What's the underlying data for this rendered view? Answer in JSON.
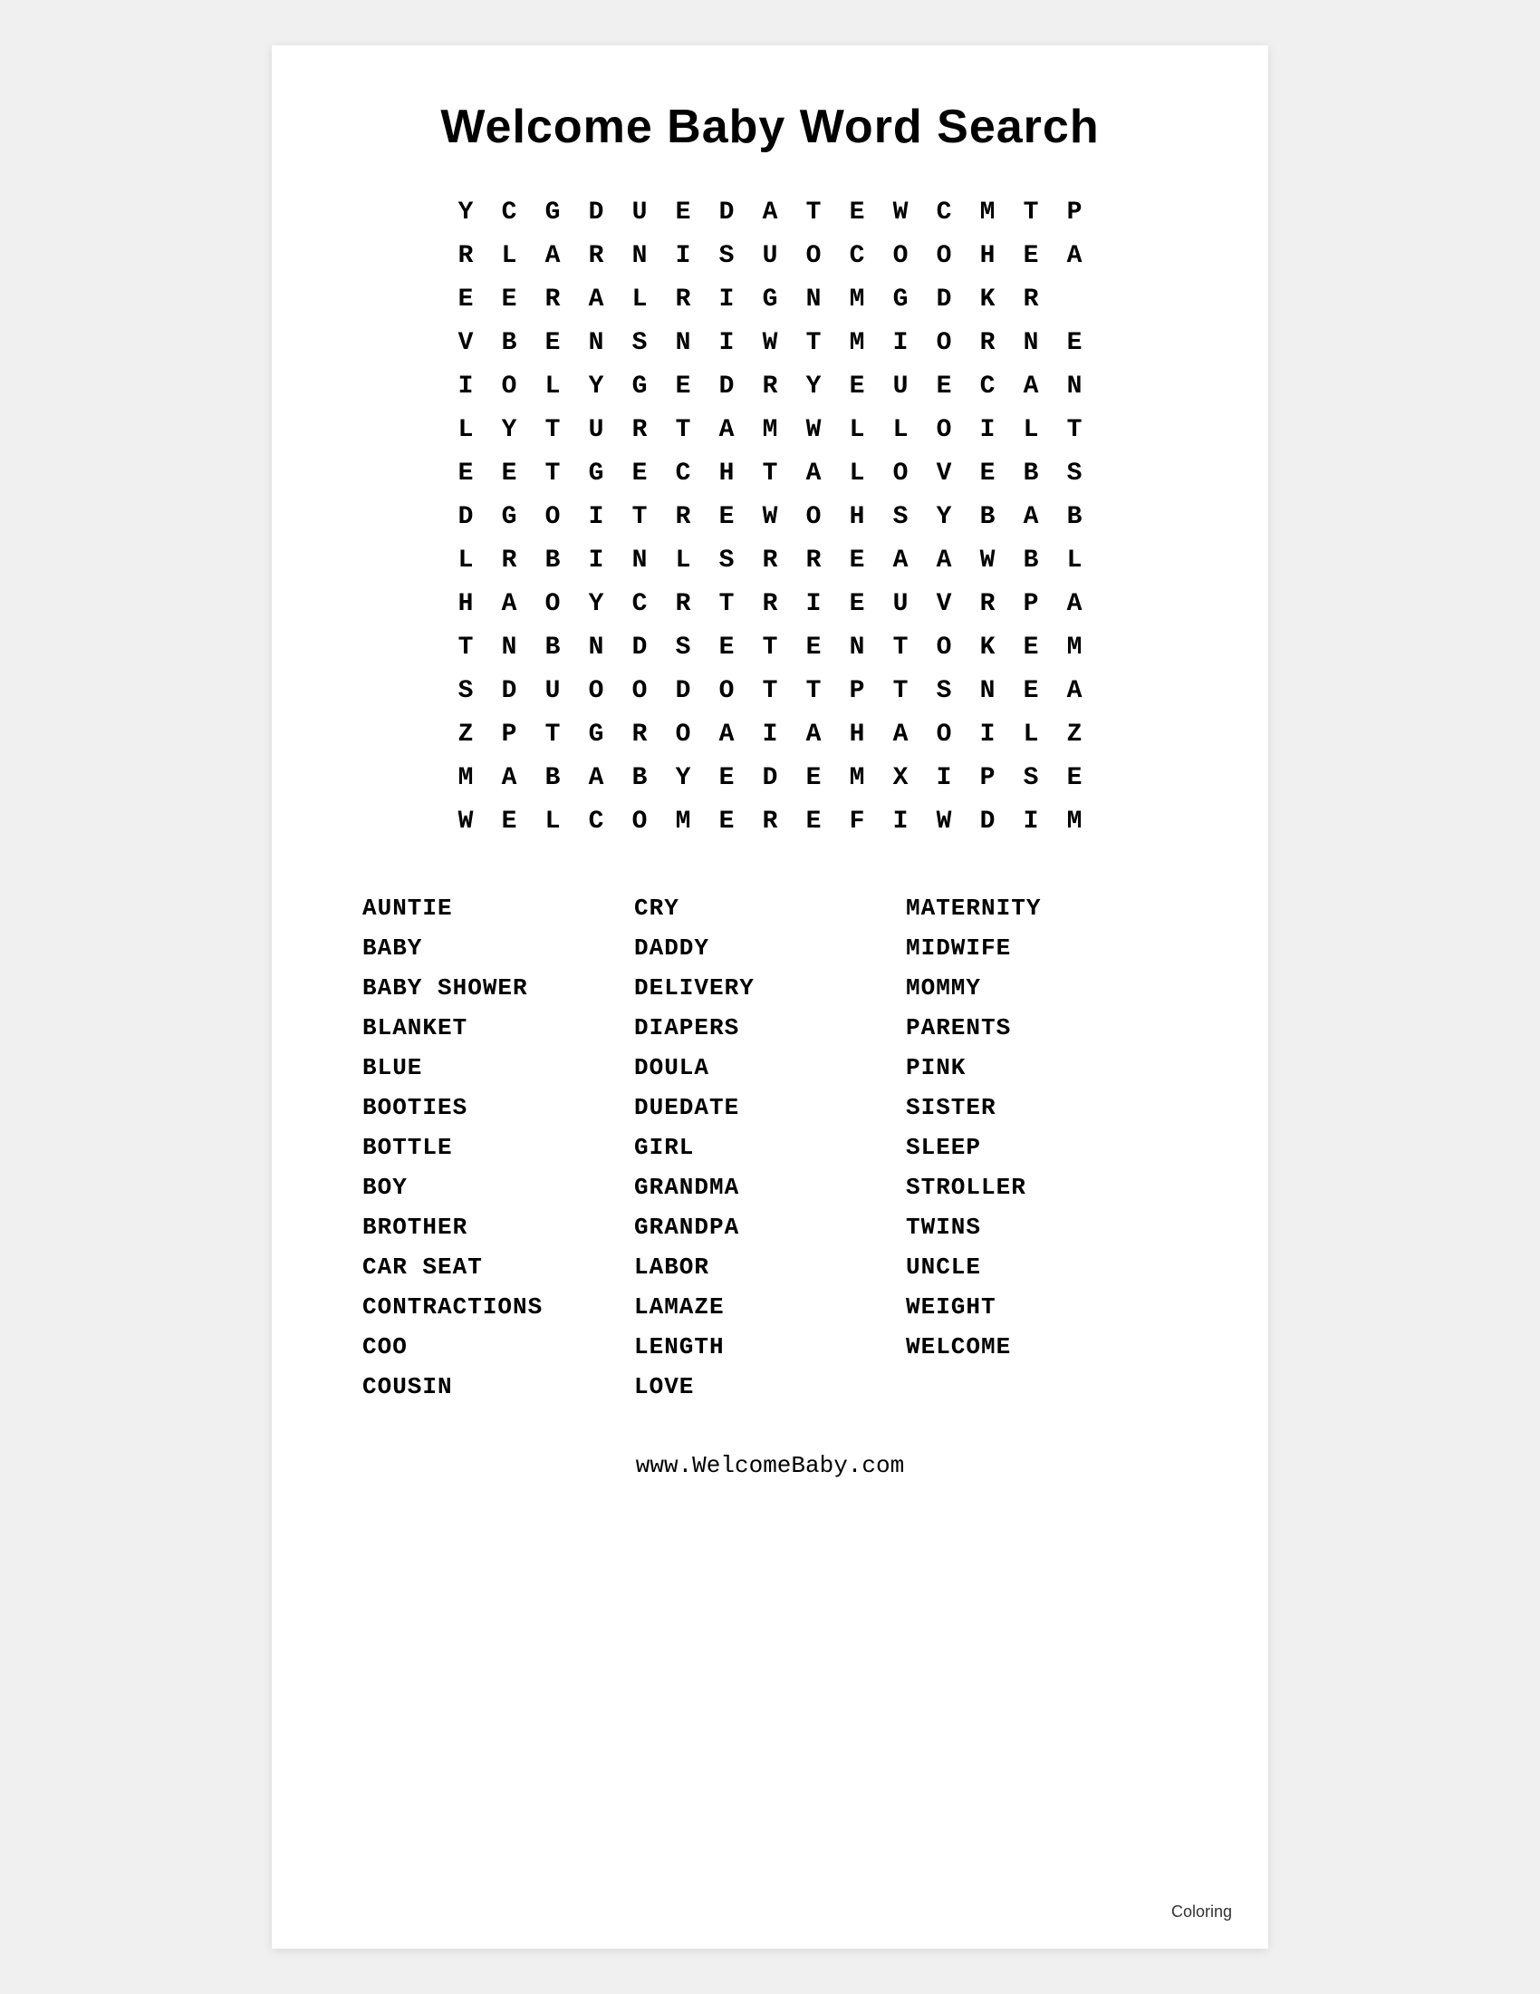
{
  "title": "Welcome Baby Word Search",
  "grid": [
    [
      "Y",
      "C",
      "G",
      "D",
      "U",
      "E",
      "D",
      "A",
      "T",
      "E",
      "W",
      "C",
      "M",
      "T",
      "P"
    ],
    [
      "R",
      "L",
      "A",
      "R",
      "N",
      "I",
      "S",
      "U",
      "O",
      "C",
      "O",
      "O",
      "H",
      "E",
      "A"
    ],
    [
      "E",
      "E",
      "R",
      "A",
      "L",
      "R",
      "I",
      "G",
      "N",
      "M",
      "G",
      "D",
      "K",
      "R",
      ""
    ],
    [
      "V",
      "B",
      "E",
      "N",
      "S",
      "N",
      "I",
      "W",
      "T",
      "M",
      "I",
      "O",
      "R",
      "N",
      "E"
    ],
    [
      "I",
      "O",
      "L",
      "Y",
      "G",
      "E",
      "D",
      "R",
      "Y",
      "E",
      "U",
      "E",
      "C",
      "A",
      "N"
    ],
    [
      "L",
      "Y",
      "T",
      "U",
      "R",
      "T",
      "A",
      "M",
      "W",
      "L",
      "L",
      "O",
      "I",
      "L",
      "T"
    ],
    [
      "E",
      "E",
      "T",
      "G",
      "E",
      "C",
      "H",
      "T",
      "A",
      "L",
      "O",
      "V",
      "E",
      "B",
      "S"
    ],
    [
      "D",
      "G",
      "O",
      "I",
      "T",
      "R",
      "E",
      "W",
      "O",
      "H",
      "S",
      "Y",
      "B",
      "A",
      "B"
    ],
    [
      "L",
      "R",
      "B",
      "I",
      "N",
      "L",
      "S",
      "R",
      "R",
      "E",
      "A",
      "A",
      "W",
      "B",
      "L"
    ],
    [
      "H",
      "A",
      "O",
      "Y",
      "C",
      "R",
      "T",
      "R",
      "I",
      "E",
      "U",
      "V",
      "R",
      "P",
      "A"
    ],
    [
      "T",
      "N",
      "B",
      "N",
      "D",
      "S",
      "E",
      "T",
      "E",
      "N",
      "T",
      "O",
      "K",
      "E",
      "M"
    ],
    [
      "S",
      "D",
      "U",
      "O",
      "O",
      "D",
      "O",
      "T",
      "T",
      "P",
      "T",
      "S",
      "N",
      "E",
      "A"
    ],
    [
      "Z",
      "P",
      "T",
      "G",
      "R",
      "O",
      "A",
      "I",
      "A",
      "H",
      "A",
      "O",
      "I",
      "L",
      "Z"
    ],
    [
      "M",
      "A",
      "B",
      "A",
      "B",
      "Y",
      "E",
      "D",
      "E",
      "M",
      "X",
      "I",
      "P",
      "S",
      "E"
    ],
    [
      "W",
      "E",
      "L",
      "C",
      "O",
      "M",
      "E",
      "R",
      "E",
      "F",
      "I",
      "W",
      "D",
      "I",
      "M"
    ]
  ],
  "words": {
    "col1": [
      "AUNTIE",
      "BABY",
      "BABY SHOWER",
      "BLANKET",
      "BLUE",
      "BOOTIES",
      "BOTTLE",
      "BOY",
      "BROTHER",
      "CAR SEAT",
      "CONTRACTIONS",
      "COO",
      "COUSIN"
    ],
    "col2": [
      "CRY",
      "DADDY",
      "DELIVERY",
      "DIAPERS",
      "DOULA",
      "DUEDATE",
      "GIRL",
      "GRANDMA",
      "GRANDPA",
      "LABOR",
      "LAMAZE",
      "LENGTH",
      "LOVE"
    ],
    "col3": [
      "MATERNITY",
      "MIDWIFE",
      "MOMMY",
      "PARENTS",
      "PINK",
      "SISTER",
      "SLEEP",
      "STROLLER",
      "TWINS",
      "UNCLE",
      "WEIGHT",
      "WELCOME",
      ""
    ]
  },
  "footer": "www.WelcomeBaby.com",
  "coloring_label": "Coloring"
}
